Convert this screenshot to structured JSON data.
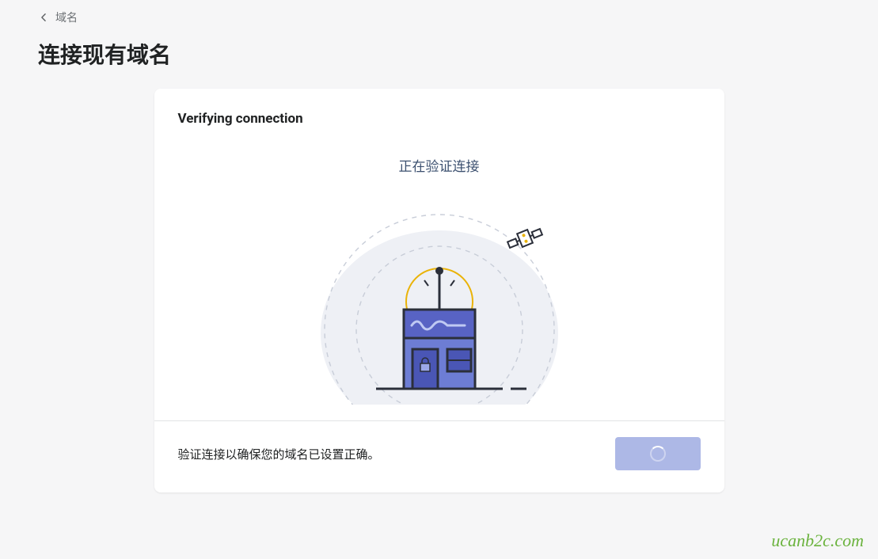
{
  "breadcrumb": {
    "label": "域名"
  },
  "page": {
    "title": "连接现有域名"
  },
  "card": {
    "title": "Verifying connection",
    "status": "正在验证连接",
    "footer_text": "验证连接以确保您的域名已设置正确。"
  },
  "watermark": {
    "text": "ucanb2c.com"
  }
}
